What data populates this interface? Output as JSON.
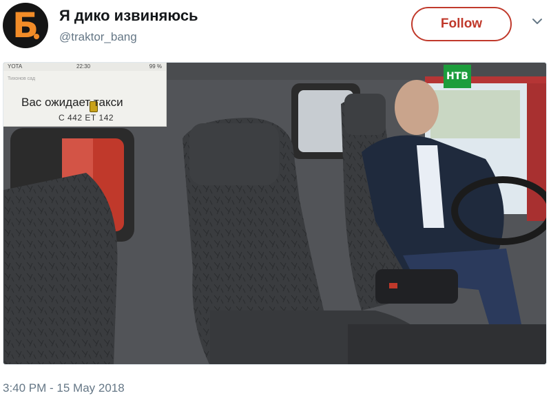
{
  "author": {
    "avatar_letter": "Б",
    "display_name": "Я дико извиняюсь",
    "handle": "@traktor_bang"
  },
  "follow_button": {
    "label": "Follow"
  },
  "media": {
    "taxi_app": {
      "status_carrier": "YOTA",
      "status_time": "22:30",
      "status_battery": "99 %",
      "map_street": "Тихонов сад",
      "title": "Вас ожидает такси",
      "plate": "С 442 ЕТ 142"
    },
    "channel_logo": "НТВ"
  },
  "timestamp": "3:40 PM - 15 May 2018",
  "colors": {
    "accent": "#c0392b",
    "brand_orange": "#f28c28",
    "secondary_text": "#657786",
    "channel_green": "#1c9d3c"
  }
}
